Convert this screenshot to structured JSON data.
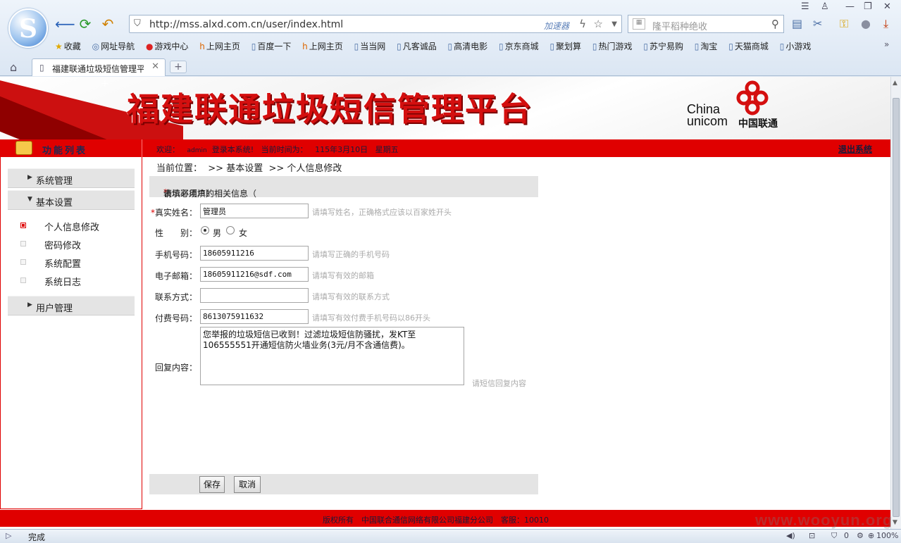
{
  "browser": {
    "url": "http://mss.alxd.com.cn/user/index.html",
    "accelerator_label": "加速器",
    "search_placeholder": "隆平稻种绝收",
    "tab_title": "福建联通垃圾短信管理平",
    "bookmarks": [
      "收藏",
      "网址导航",
      "游戏中心",
      "上网主页",
      "百度一下",
      "上网主页",
      "当当网",
      "凡客诚品",
      "高清电影",
      "京东商城",
      "聚划算",
      "热门游戏",
      "苏宁易购",
      "淘宝",
      "天猫商城",
      "小游戏"
    ],
    "status_text": "完成",
    "status_count": "0",
    "zoom": "100%"
  },
  "header": {
    "title": "福建联通垃圾短信管理平台",
    "logo_line1": "China",
    "logo_line2": "unicom",
    "logo_cn": "中国联通"
  },
  "topbar": {
    "func_title": "功能列表",
    "welcome": "欢迎：",
    "user": "admin",
    "login_text": "登录本系统!",
    "time_label": "当前时间为：",
    "date": "115年3月10日",
    "weekday": "星期五",
    "logout": "退出系统"
  },
  "sidebar": {
    "groups": [
      {
        "label": "系统管理",
        "expanded": false
      },
      {
        "label": "基本设置",
        "expanded": true
      },
      {
        "label": "用户管理",
        "expanded": false
      }
    ],
    "subitems": [
      "个人信息修改",
      "密码修改",
      "系统配置",
      "系统日志"
    ]
  },
  "breadcrumb": {
    "prefix": "当前位置：",
    "level1": ">> 基本设置",
    "level2": ">> 个人信息修改"
  },
  "form": {
    "heading": "请填写用户的相关信息（",
    "heading_star": "*",
    "heading_tail": " 表示必须填）",
    "name_label": "真实姓名：",
    "name_value": "管理员",
    "name_hint": "请填写姓名，正确格式应该以百家姓开头",
    "gender_label": "性　　别：",
    "gender_male": "男",
    "gender_female": "女",
    "gender_selected": "男",
    "phone_label": "手机号码：",
    "phone_value": "18605911216",
    "phone_hint": "请填写正确的手机号码",
    "email_label": "电子邮箱：",
    "email_value": "18605911216@sdf.com",
    "email_hint": "请填写有效的邮箱",
    "contact_label": "联系方式：",
    "contact_value": "",
    "contact_hint": "请填写有效的联系方式",
    "pay_label": "付费号码：",
    "pay_value": "8613075911632",
    "pay_hint": "请填写有效付费手机号码以86开头",
    "reply_label": "回复内容：",
    "reply_value": "您举报的垃圾短信已收到！过滤垃圾短信防骚扰，发KT至106555551开通短信防火墙业务(3元/月不含通信费)。",
    "reply_hint": "请短信回复内容",
    "save": "保存",
    "cancel": "取消"
  },
  "footer": {
    "text": "版权所有　中国联合通信网络有限公司福建分公司　客服：10010"
  },
  "watermark": "www.wooyun.org",
  "colors": {
    "brand_red": "#e00000",
    "accent_blue": "#4a6ea5"
  }
}
